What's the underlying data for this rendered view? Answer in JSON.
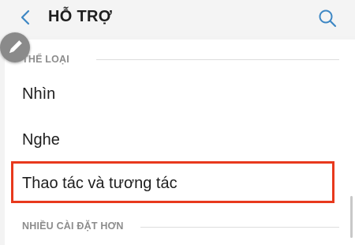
{
  "header": {
    "title": "HỖ TRỢ",
    "back_icon": "chevron-left-icon",
    "search_icon": "search-icon",
    "accent_color": "#3d87c4"
  },
  "fab": {
    "icon": "pencil-icon"
  },
  "sections": [
    {
      "label": "THỂ LOẠI",
      "items": [
        "Nhìn",
        "Nghe",
        "Thao tác và tương tác"
      ]
    },
    {
      "label": "NHIỀU CÀI ĐẶT HƠN"
    }
  ],
  "highlight_color": "#e8391d"
}
